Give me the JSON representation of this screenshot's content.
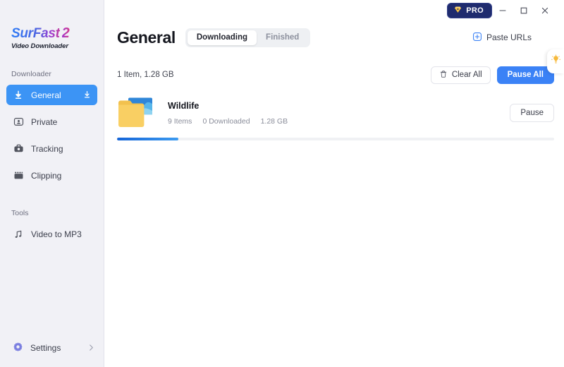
{
  "app": {
    "logo_name": "SurFast",
    "logo_version": "2",
    "logo_subtitle": "Video Downloader"
  },
  "titlebar": {
    "pro_label": "PRO",
    "pro_icon": "crown-gem-icon",
    "minimize_icon": "minimize-icon",
    "maximize_icon": "maximize-icon",
    "close_icon": "close-icon"
  },
  "sidebar": {
    "section_downloader": "Downloader",
    "section_tools": "Tools",
    "items": [
      {
        "label": "General",
        "icon": "download-arrow-icon",
        "trailing_icon": "download-to-line-icon",
        "active": true
      },
      {
        "label": "Private",
        "icon": "private-user-icon",
        "active": false
      },
      {
        "label": "Tracking",
        "icon": "tracking-camera-icon",
        "active": false
      },
      {
        "label": "Clipping",
        "icon": "clipping-film-icon",
        "active": false
      }
    ],
    "tools": [
      {
        "label": "Video to MP3",
        "icon": "music-note-icon"
      }
    ],
    "settings": {
      "label": "Settings",
      "icon": "gear-icon",
      "chevron": "chevron-right-icon"
    }
  },
  "header": {
    "title": "General",
    "tabs": [
      {
        "label": "Downloading",
        "active": true
      },
      {
        "label": "Finished",
        "active": false
      }
    ],
    "paste_urls_label": "Paste URLs",
    "paste_urls_icon": "plus-square-icon",
    "tip_icon": "lightbulb-icon"
  },
  "toolbar": {
    "count_text": "1 Item, 1.28 GB",
    "clear_all_label": "Clear All",
    "clear_all_icon": "trash-icon",
    "pause_all_label": "Pause All"
  },
  "downloads": [
    {
      "title": "Wildlife",
      "icon": "folder-image-icon",
      "items_count": "9 Items",
      "downloaded": "0 Downloaded",
      "size": "1.28 GB",
      "action_label": "Pause",
      "progress_percent": 14
    }
  ],
  "colors": {
    "accent_blue": "#3b82f6",
    "sidebar_active": "#3c94f5",
    "pro_navy": "#1f2b6e",
    "pro_gold": "#f5c044",
    "folder_yellow": "#f9cf63",
    "sidebar_bg": "#f1f1f6"
  }
}
